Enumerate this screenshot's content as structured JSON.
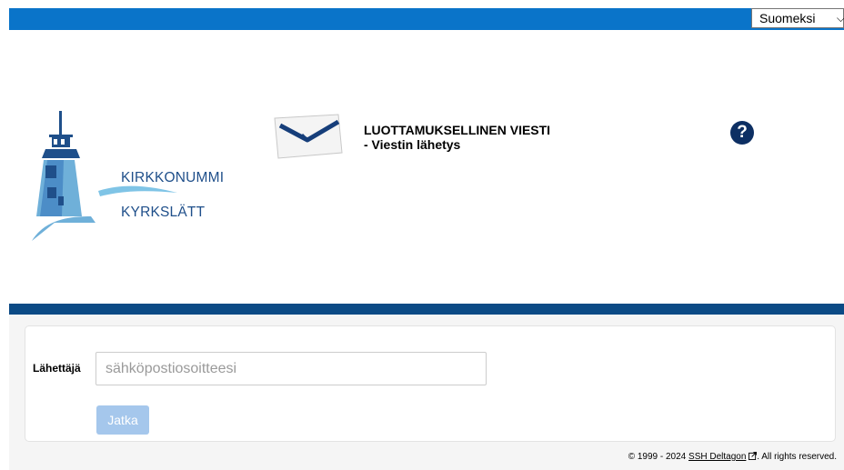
{
  "header": {
    "language": "Suomeksi"
  },
  "logo": {
    "line1": "KIRKKONUMMI",
    "line2": "KYRKSLÄTT"
  },
  "title": {
    "line1": "LUOTTAMUKSELLINEN VIESTI",
    "line2": "- Viestin lähetys"
  },
  "form": {
    "sender_label": "Lähettäjä",
    "email_placeholder": "sähköpostiosoitteesi",
    "email_value": "",
    "continue_label": "Jatka"
  },
  "footer": {
    "prefix": "© 1999 - 2024",
    "link": "SSH Deltagon",
    "suffix": ". All rights reserved."
  },
  "colors": {
    "top_bar": "#0a74c9",
    "mid_bar": "#0b4a85",
    "help_icon": "#0d2f63",
    "button_disabled": "#a5c7ec"
  },
  "icons": {
    "help": "question-mark-circle-icon",
    "envelope": "envelope-icon",
    "dropdown": "chevron-down-icon",
    "external": "external-link-icon"
  }
}
